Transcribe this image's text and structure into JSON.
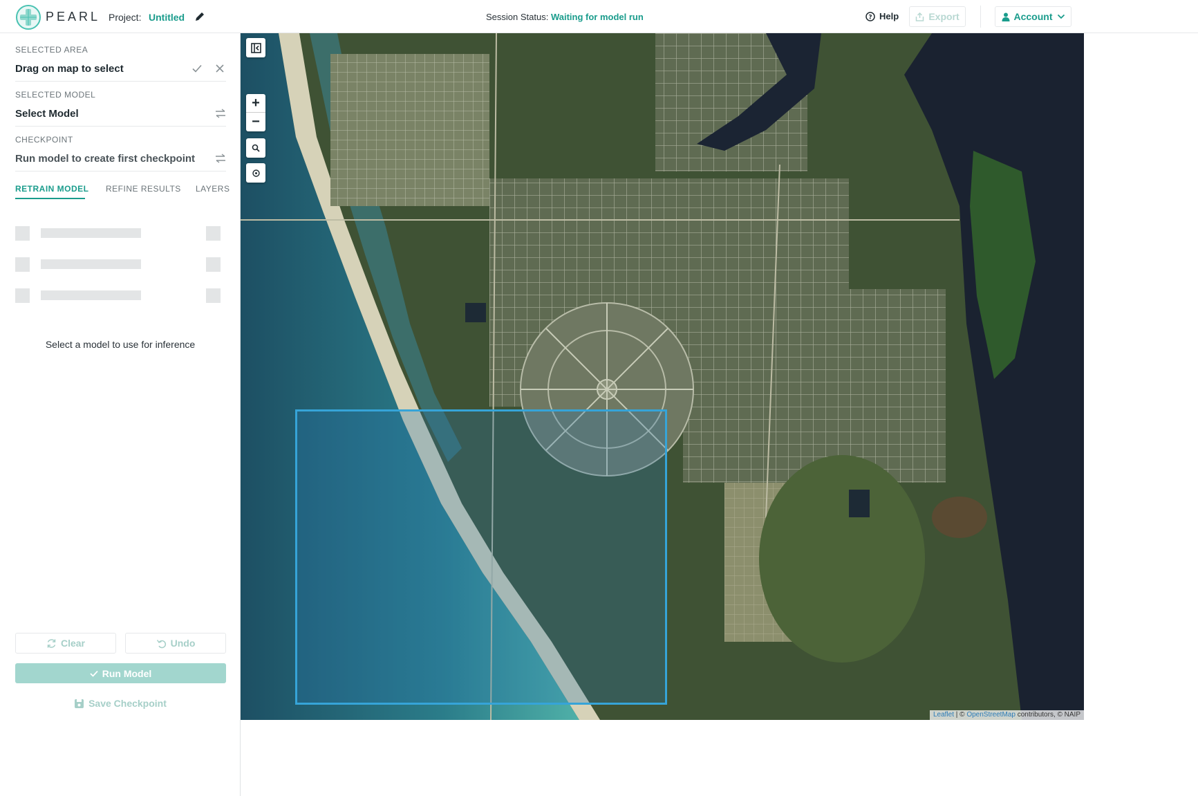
{
  "header": {
    "brand": "PEARL",
    "project_label": "Project:",
    "project_name": "Untitled",
    "session_label": "Session Status:",
    "session_status": "Waiting for model run",
    "help_label": "Help",
    "export_label": "Export",
    "account_label": "Account"
  },
  "sidebar": {
    "selected_area": {
      "label": "Selected Area",
      "value": "Drag on map to select"
    },
    "selected_model": {
      "label": "Selected Model",
      "value": "Select Model"
    },
    "checkpoint": {
      "label": "Checkpoint",
      "value": "Run model to create first checkpoint"
    },
    "tabs": [
      {
        "label": "RETRAIN MODEL",
        "active": true
      },
      {
        "label": "REFINE RESULTS",
        "active": false
      },
      {
        "label": "LAYERS",
        "active": false
      }
    ],
    "hint": "Select a model to use for inference",
    "clear_label": "Clear",
    "undo_label": "Undo",
    "run_label": "Run Model",
    "save_checkpoint_label": "Save Checkpoint"
  },
  "map": {
    "zoom_in": "+",
    "zoom_out": "−",
    "attribution": {
      "leaflet": "Leaflet",
      "sep": " | © ",
      "osm": "OpenStreetMap",
      "rest": " contributors, © NAIP"
    }
  },
  "colors": {
    "accent": "#1a9c8c",
    "selection": "#36a4d8"
  },
  "icons": [
    "logo-icon",
    "pencil-icon",
    "help-icon",
    "export-icon",
    "user-icon",
    "chevron-down-icon",
    "check-icon",
    "close-icon",
    "swap-icon",
    "refresh-icon",
    "undo-icon",
    "save-icon",
    "collapse-sidebar-icon",
    "search-icon",
    "locate-icon"
  ]
}
